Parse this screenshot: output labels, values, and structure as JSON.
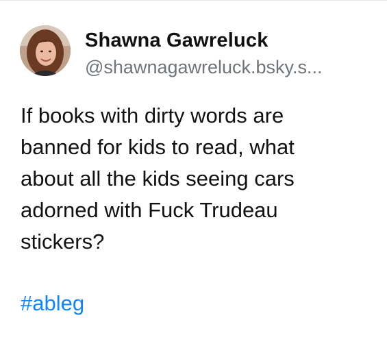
{
  "author": {
    "display_name": "Shawna Gawreluck",
    "handle": "@shawnagawreluck.bsky.s..."
  },
  "post": {
    "lines": [
      "If books with dirty words are",
      "banned for kids to read, what",
      "about all the kids seeing cars",
      "adorned with Fuck Trudeau",
      "stickers?"
    ],
    "hashtag": "#ableg"
  },
  "colors": {
    "link": "#1185fe",
    "handle": "#6f7479",
    "text": "#111111",
    "background": "#ffffff"
  }
}
